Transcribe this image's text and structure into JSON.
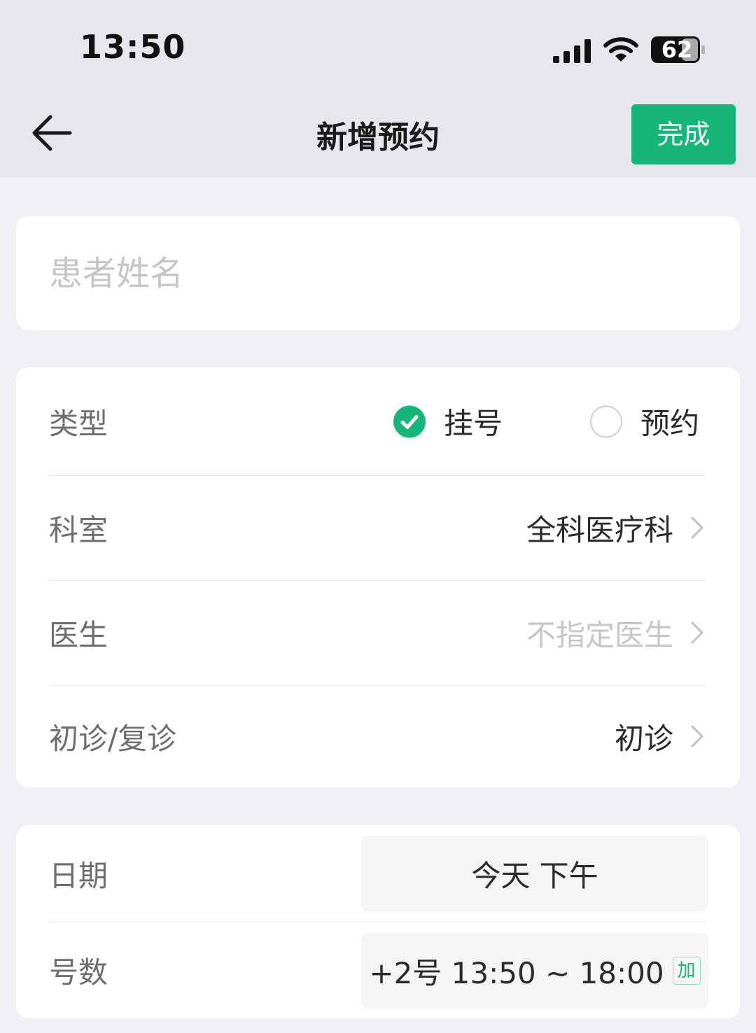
{
  "status_bar": {
    "time": "13:50",
    "battery": "62"
  },
  "nav": {
    "title": "新增预约",
    "done_label": "完成"
  },
  "patient": {
    "placeholder": "患者姓名",
    "value": ""
  },
  "form": {
    "type": {
      "label": "类型",
      "options": [
        {
          "label": "挂号",
          "selected": true
        },
        {
          "label": "预约",
          "selected": false
        }
      ]
    },
    "department": {
      "label": "科室",
      "value": "全科医疗科"
    },
    "doctor": {
      "label": "医生",
      "value": "不指定医生"
    },
    "visit": {
      "label": "初诊/复诊",
      "value": "初诊"
    }
  },
  "schedule": {
    "date": {
      "label": "日期",
      "value": "今天 下午"
    },
    "number": {
      "label": "号数",
      "value": "+2号 13:50 ~ 18:00",
      "badge": "加"
    }
  },
  "colors": {
    "accent": "#16b578",
    "background": "#efeff4",
    "header": "#e6e6eb"
  }
}
